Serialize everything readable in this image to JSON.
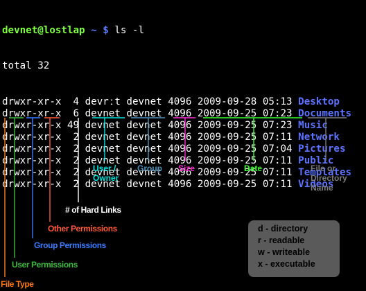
{
  "terminal": {
    "prompt_user": "devnet@lostlap",
    "prompt_path": " ~ $",
    "command": " ls -l",
    "total": "total 32",
    "rows": [
      {
        "perm": "drwxr-xr-x",
        "links": " 4",
        "owner": "devrːt",
        "group": "devnet",
        "size": "4096",
        "date": "2009-09-28",
        "time": "05:13",
        "name": "Desktop"
      },
      {
        "perm": "drwxr-xr-x",
        "links": " 6",
        "owner": "devnet",
        "group": "devnet",
        "size": "4096",
        "date": "2009-09-25",
        "time": "07:23",
        "name": "Documents"
      },
      {
        "perm": "drwxr-xr-x",
        "links": "49",
        "owner": "devnet",
        "group": "devnet",
        "size": "4096",
        "date": "2009-09-25",
        "time": "07:23",
        "name": "Music"
      },
      {
        "perm": "drwxr-xr-x",
        "links": " 2",
        "owner": "devnet",
        "group": "devnet",
        "size": "4096",
        "date": "2009-09-25",
        "time": "07:11",
        "name": "Network"
      },
      {
        "perm": "drwxr-xr-x",
        "links": " 2",
        "owner": "devnet",
        "group": "devnet",
        "size": "4096",
        "date": "2009-09-25",
        "time": "07:04",
        "name": "Pictures"
      },
      {
        "perm": "drwxr-xr-x",
        "links": " 2",
        "owner": "devnet",
        "group": "devnet",
        "size": "4096",
        "date": "2009-09-25",
        "time": "07:11",
        "name": "Public"
      },
      {
        "perm": "drwxr-xr-x",
        "links": " 2",
        "owner": "devnet",
        "group": "devnet",
        "size": "4096",
        "date": "2009-09-25",
        "time": "07:11",
        "name": "Templates"
      },
      {
        "perm": "drwxr-xr-x",
        "links": " 2",
        "owner": "devnet",
        "group": "devnet",
        "size": "4096",
        "date": "2009-09-25",
        "time": "07:11",
        "name": "Videos"
      }
    ]
  },
  "annotations": {
    "user_owner": {
      "line1": "User /",
      "line2": "Owner",
      "color": "#00e5e0"
    },
    "group": {
      "text": "Group",
      "color": "#4a8fb8"
    },
    "size": {
      "text": "Size",
      "color": "#ff2fd8"
    },
    "date": {
      "text": "Date",
      "color": "#39ff2f"
    },
    "file_or_dir": {
      "line1": "File or",
      "line2": "Directory",
      "line3": "Name",
      "color": "#7a7a7a"
    },
    "hard_links": {
      "text": "# of Hard Links",
      "color": "#ffffff"
    },
    "other_perms": {
      "text": "Other Permissions",
      "color": "#ff5a3a"
    },
    "group_perms": {
      "text": "Group Permissions",
      "color": "#3a7cff"
    },
    "user_perms": {
      "text": "User Permissions",
      "color": "#3dbb3d"
    },
    "file_type": {
      "text": "File Type",
      "color": "#ff7a1a"
    }
  },
  "legend": {
    "items": [
      "d - directory",
      "r - readable",
      "w - writeable",
      "x - executable"
    ]
  }
}
